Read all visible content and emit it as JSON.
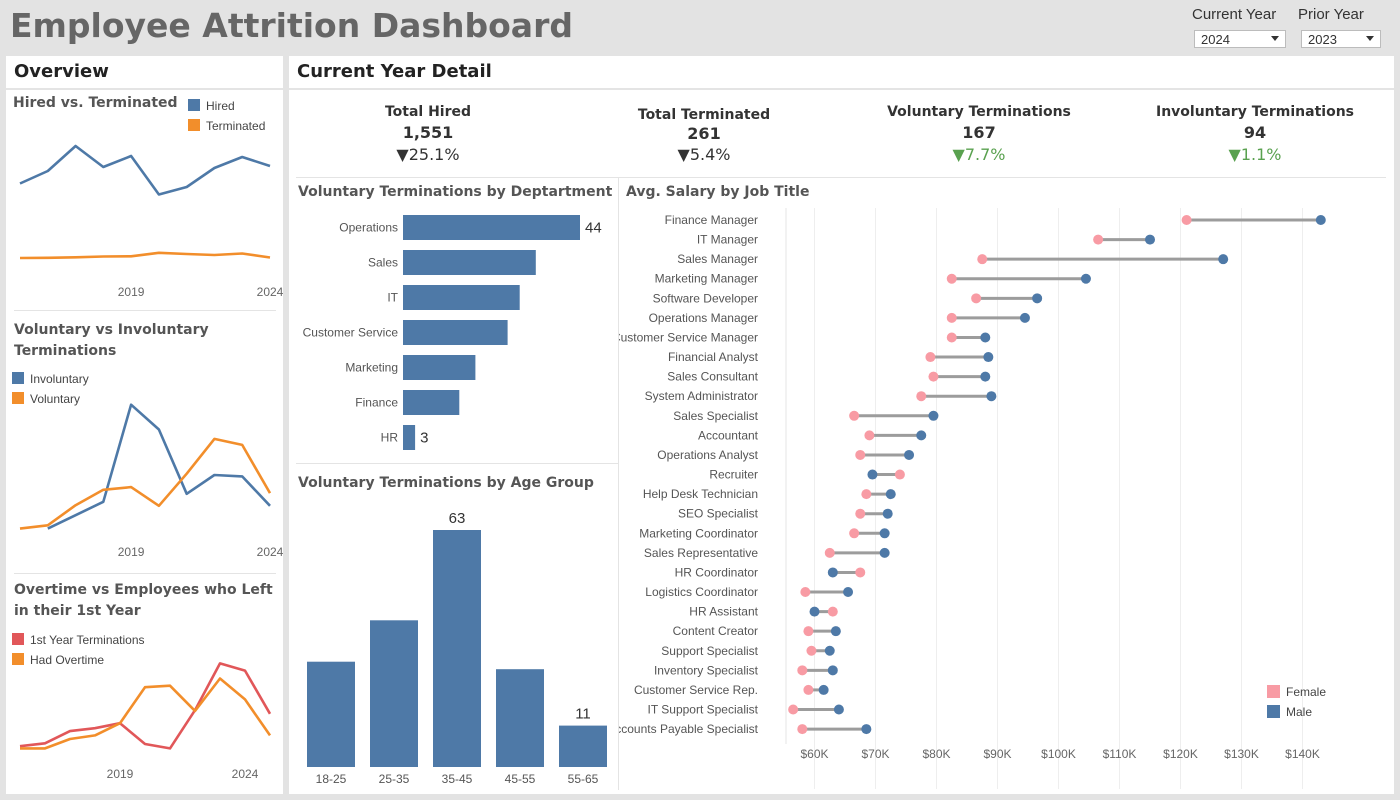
{
  "title": "Employee Attrition Dashboard",
  "filters": {
    "current_label": "Current Year",
    "current_value": "2024",
    "prior_label": "Prior Year",
    "prior_value": "2023"
  },
  "colors": {
    "blue": "#4e79a7",
    "orange": "#f28e2b",
    "red": "#e15759",
    "pink": "#f89ba4",
    "grey_line": "#9c9c9c",
    "green": "#59a14f"
  },
  "overview": {
    "header": "Overview",
    "hired_vs_terminated": {
      "title": "Hired vs. Terminated",
      "legend": [
        "Hired",
        "Terminated"
      ]
    },
    "vol_vs_invol": {
      "title": "Voluntary vs Involuntary Terminations",
      "legend": [
        "Involuntary",
        "Voluntary"
      ]
    },
    "overtime": {
      "title": "Overtime vs Employees who Left in their 1st Year",
      "legend": [
        "1st Year Terminations",
        "Had Overtime"
      ]
    }
  },
  "detail": {
    "header": "Current Year Detail",
    "kpis": [
      {
        "title": "Total Hired",
        "value": "1,551",
        "change": "▼25.1%",
        "color": "#333333"
      },
      {
        "title": "Total Terminated",
        "value": "261",
        "change": "▼5.4%",
        "color": "#333333"
      },
      {
        "title": "Voluntary Terminations",
        "value": "167",
        "change": "▼7.7%",
        "color": "#59a14f"
      },
      {
        "title": "Involuntary Terminations",
        "value": "94",
        "change": "▼1.1%",
        "color": "#59a14f"
      }
    ]
  },
  "chart_data": [
    {
      "id": "hired_vs_terminated",
      "type": "line",
      "title": "Hired vs. Terminated",
      "x_ticks": [
        "2019",
        "2024"
      ],
      "series": [
        {
          "name": "Hired",
          "color": "#4e79a7",
          "values": [
            1750,
            2000,
            2500,
            2080,
            2300,
            1530,
            1680,
            2060,
            2280,
            2100
          ]
        },
        {
          "name": "Terminated",
          "color": "#f28e2b",
          "values": [
            260,
            265,
            275,
            290,
            295,
            365,
            340,
            320,
            350,
            270
          ]
        }
      ],
      "ylim": [
        0,
        2700
      ]
    },
    {
      "id": "vol_vs_invol",
      "type": "line",
      "title": "Voluntary vs Involuntary Terminations",
      "x_ticks": [
        "2019",
        "2024"
      ],
      "series": [
        {
          "name": "Involuntary",
          "color": "#4e79a7",
          "values": [
            null,
            60,
            80,
            100,
            245,
            208,
            112,
            140,
            138,
            94
          ]
        },
        {
          "name": "Voluntary",
          "color": "#f28e2b",
          "values": [
            60,
            65,
            95,
            118,
            122,
            94,
            142,
            194,
            185,
            113
          ]
        }
      ],
      "ylim": [
        40,
        270
      ]
    },
    {
      "id": "overtime",
      "type": "line",
      "title": "Overtime vs Employees who Left in their 1st Year",
      "x_ticks": [
        "2019",
        "2024"
      ],
      "series": [
        {
          "name": "1st Year Terminations",
          "color": "#e15759",
          "values": [
            15,
            19,
            36,
            40,
            47,
            18,
            12,
            65,
            130,
            120,
            60
          ]
        },
        {
          "name": "Had Overtime",
          "color": "#f28e2b",
          "values": [
            12,
            12,
            25,
            30,
            47,
            97,
            99,
            64,
            109,
            80,
            30
          ]
        }
      ],
      "ylim": [
        0,
        150
      ]
    },
    {
      "id": "vol_by_dept",
      "type": "bar",
      "orientation": "horizontal",
      "title": "Voluntary Terminations by Deptartment",
      "categories": [
        "Operations",
        "Sales",
        "IT",
        "Customer Service",
        "Marketing",
        "Finance",
        "HR"
      ],
      "values": [
        44,
        33,
        29,
        26,
        18,
        14,
        3
      ],
      "data_labels": [
        "44",
        "",
        "",
        "",
        "",
        "",
        "3"
      ],
      "xlim": [
        0,
        44
      ]
    },
    {
      "id": "vol_by_age",
      "type": "bar",
      "title": "Voluntary Terminations by Age Group",
      "categories": [
        "18-25",
        "25-35",
        "35-45",
        "45-55",
        "55-65"
      ],
      "values": [
        28,
        39,
        63,
        26,
        11
      ],
      "data_labels": [
        "",
        "",
        "63",
        "",
        "11"
      ],
      "ylim": [
        0,
        63
      ]
    },
    {
      "id": "salary_by_job",
      "type": "scatter",
      "subtype": "dumbbell",
      "title": "Avg. Salary by Job Title",
      "legend": [
        "Female",
        "Male"
      ],
      "x_ticks": [
        "$60K",
        "$70K",
        "$80K",
        "$90K",
        "$100K",
        "$110K",
        "$120K",
        "$130K",
        "$140K"
      ],
      "xlim": [
        55000,
        144000
      ],
      "rows": [
        {
          "job": "Finance Manager",
          "female": 121000,
          "male": 143000
        },
        {
          "job": "IT Manager",
          "female": 106500,
          "male": 115000
        },
        {
          "job": "Sales Manager",
          "female": 87500,
          "male": 127000
        },
        {
          "job": "Marketing Manager",
          "female": 82500,
          "male": 104500
        },
        {
          "job": "Software Developer",
          "female": 86500,
          "male": 96500
        },
        {
          "job": "Operations Manager",
          "female": 82500,
          "male": 94500
        },
        {
          "job": "Customer Service Manager",
          "female": 82500,
          "male": 88000
        },
        {
          "job": "Financial Analyst",
          "female": 79000,
          "male": 88500
        },
        {
          "job": "Sales Consultant",
          "female": 79500,
          "male": 88000
        },
        {
          "job": "System Administrator",
          "female": 77500,
          "male": 89000
        },
        {
          "job": "Sales Specialist",
          "female": 66500,
          "male": 79500
        },
        {
          "job": "Accountant",
          "female": 69000,
          "male": 77500
        },
        {
          "job": "Operations Analyst",
          "female": 67500,
          "male": 75500
        },
        {
          "job": "Recruiter",
          "female": 74000,
          "male": 69500
        },
        {
          "job": "Help Desk Technician",
          "female": 68500,
          "male": 72500
        },
        {
          "job": "SEO Specialist",
          "female": 67500,
          "male": 72000
        },
        {
          "job": "Marketing Coordinator",
          "female": 66500,
          "male": 71500
        },
        {
          "job": "Sales Representative",
          "female": 62500,
          "male": 71500
        },
        {
          "job": "HR Coordinator",
          "female": 67500,
          "male": 63000
        },
        {
          "job": "Logistics Coordinator",
          "female": 58500,
          "male": 65500
        },
        {
          "job": "HR Assistant",
          "female": 63000,
          "male": 60000
        },
        {
          "job": "Content Creator",
          "female": 59000,
          "male": 63500
        },
        {
          "job": "Support Specialist",
          "female": 59500,
          "male": 62500
        },
        {
          "job": "Inventory Specialist",
          "female": 58000,
          "male": 63000
        },
        {
          "job": "Customer Service Rep.",
          "female": 59000,
          "male": 61500
        },
        {
          "job": "IT Support Specialist",
          "female": 56500,
          "male": 64000
        },
        {
          "job": "Accounts Payable Specialist",
          "female": 58000,
          "male": 68500
        }
      ]
    }
  ]
}
